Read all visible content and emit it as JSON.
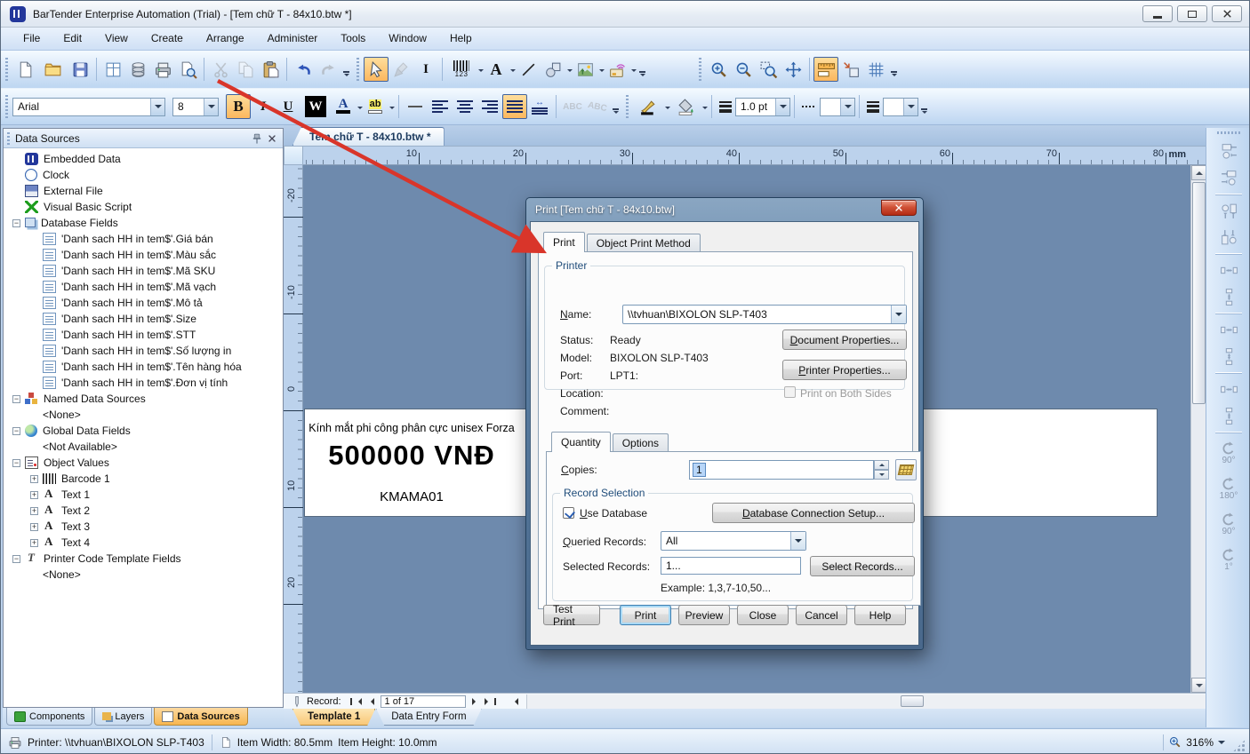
{
  "window": {
    "title": "BarTender Enterprise Automation (Trial) - [Tem chữ T - 84x10.btw *]",
    "menus": [
      "File",
      "Edit",
      "View",
      "Create",
      "Arrange",
      "Administer",
      "Tools",
      "Window",
      "Help"
    ]
  },
  "toolbar": {
    "font_name": "Arial",
    "font_size": "8",
    "line_weight": "1.0 pt",
    "glyphs": {
      "bold": "B",
      "italic": "I",
      "underline": "U",
      "wizard": "W",
      "font_color": "A",
      "highlight": "ab",
      "abc_up": "ABC",
      "abc_down": "ABC",
      "ibeam": "I",
      "text_tool": "A",
      "barcode_num": "123"
    }
  },
  "data_sources_panel": {
    "title": "Data Sources",
    "tree": [
      {
        "icon": "embedded",
        "label": "Embedded Data",
        "ind": 0
      },
      {
        "icon": "clock",
        "label": "Clock",
        "ind": 0
      },
      {
        "icon": "file",
        "label": "External File",
        "ind": 0
      },
      {
        "icon": "vbs",
        "label": "Visual Basic Script",
        "ind": 0
      },
      {
        "e": "-",
        "icon": "dbfields",
        "label": "Database Fields",
        "ind": 0
      },
      {
        "icon": "field",
        "label": "'Danh sach HH in tem$'.Giá bán",
        "ind": 1
      },
      {
        "icon": "field",
        "label": "'Danh sach HH in tem$'.Màu sắc",
        "ind": 1
      },
      {
        "icon": "field",
        "label": "'Danh sach HH in tem$'.Mã SKU",
        "ind": 1
      },
      {
        "icon": "field",
        "label": "'Danh sach HH in tem$'.Mã vạch",
        "ind": 1
      },
      {
        "icon": "field",
        "label": "'Danh sach HH in tem$'.Mô tả",
        "ind": 1
      },
      {
        "icon": "field",
        "label": "'Danh sach HH in tem$'.Size",
        "ind": 1
      },
      {
        "icon": "field",
        "label": "'Danh sach HH in tem$'.STT",
        "ind": 1
      },
      {
        "icon": "field",
        "label": "'Danh sach HH in tem$'.Số lượng in",
        "ind": 1
      },
      {
        "icon": "field",
        "label": "'Danh sach HH in tem$'.Tên hàng hóa",
        "ind": 1
      },
      {
        "icon": "field",
        "label": "'Danh sach HH in tem$'.Đơn vị tính",
        "ind": 1
      },
      {
        "e": "-",
        "icon": "named",
        "label": "Named Data Sources",
        "ind": 0
      },
      {
        "label": "<None>",
        "ind": 1,
        "noicon": true
      },
      {
        "e": "-",
        "icon": "globe",
        "label": "Global Data Fields",
        "ind": 0
      },
      {
        "label": "<Not Available>",
        "ind": 1,
        "noicon": true
      },
      {
        "e": "-",
        "icon": "objvals",
        "label": "Object Values",
        "ind": 0
      },
      {
        "e": "+",
        "icon": "barcode",
        "label": "Barcode 1",
        "ind": 1
      },
      {
        "e": "+",
        "icon": "textA",
        "label": "Text 1",
        "ind": 1
      },
      {
        "e": "+",
        "icon": "textA",
        "label": "Text 2",
        "ind": 1
      },
      {
        "e": "+",
        "icon": "textA",
        "label": "Text 3",
        "ind": 1
      },
      {
        "e": "+",
        "icon": "textA",
        "label": "Text 4",
        "ind": 1
      },
      {
        "e": "-",
        "icon": "pct",
        "label": "Printer Code Template Fields",
        "ind": 0
      },
      {
        "label": "<None>",
        "ind": 1,
        "noicon": true
      }
    ],
    "bottom_tabs": [
      {
        "label": "Components",
        "icon": "components"
      },
      {
        "label": "Layers",
        "icon": "layers"
      },
      {
        "label": "Data Sources",
        "icon": "ab",
        "active": true
      }
    ]
  },
  "document": {
    "tab_title": "Tem chữ T - 84x10.btw *",
    "h_ruler": [
      "10",
      "20",
      "30",
      "40",
      "50",
      "60",
      "70",
      "80"
    ],
    "ruler_unit": "mm",
    "v_ruler": [
      "-20",
      "-10",
      "0",
      "10",
      "20"
    ],
    "label_preview": {
      "name": "Kính mắt phi công phân cực unisex Forza",
      "price": "500000 VNĐ",
      "sku": "KMAMA01"
    },
    "record_bar": {
      "label": "Record:",
      "position": "1 of 17"
    },
    "bottom_tabs": [
      {
        "label": "Template 1",
        "active": true
      },
      {
        "label": "Data Entry Form"
      }
    ]
  },
  "print_dialog": {
    "title": "Print [Tem chữ T - 84x10.btw]",
    "tabs": [
      {
        "label": "Print",
        "active": true
      },
      {
        "label": "Object Print Method"
      }
    ],
    "printer": {
      "legend": "Printer",
      "name_label": "Name:",
      "name_value": "\\\\tvhuan\\BIXOLON SLP-T403",
      "status_label": "Status:",
      "status_value": "Ready",
      "model_label": "Model:",
      "model_value": "BIXOLON SLP-T403",
      "port_label": "Port:",
      "port_value": "LPT1:",
      "location_label": "Location:",
      "comment_label": "Comment:",
      "document_properties_button": "Document Properties...",
      "printer_properties_button": "Printer Properties...",
      "both_sides_label": "Print on Both Sides"
    },
    "quantity_tabs": [
      {
        "label": "Quantity",
        "active": true
      },
      {
        "label": "Options"
      }
    ],
    "quantity": {
      "copies_label": "Copies:",
      "copies_value": "1",
      "record_selection_legend": "Record Selection",
      "use_database_label": "Use Database",
      "db_setup_button": "Database Connection Setup...",
      "queried_label": "Queried Records:",
      "queried_value": "All",
      "selected_label": "Selected Records:",
      "selected_value": "1...",
      "select_records_button": "Select Records...",
      "example_text": "Example: 1,3,7-10,50..."
    },
    "buttons": [
      {
        "label": "Test Print"
      },
      {
        "label": "Print",
        "default": true
      },
      {
        "label": "Preview"
      },
      {
        "label": "Close"
      },
      {
        "label": "Cancel"
      },
      {
        "label": "Help"
      }
    ]
  },
  "right_toolbar": {
    "rotate_labels": [
      "90°",
      "180°",
      "90°",
      "1°"
    ]
  },
  "status_bar": {
    "printer": "Printer: \\\\tvhuan\\BIXOLON SLP-T403",
    "item_width": "Item Width: 80.5mm",
    "item_height": "Item Height: 10.0mm",
    "zoom": "316%"
  }
}
